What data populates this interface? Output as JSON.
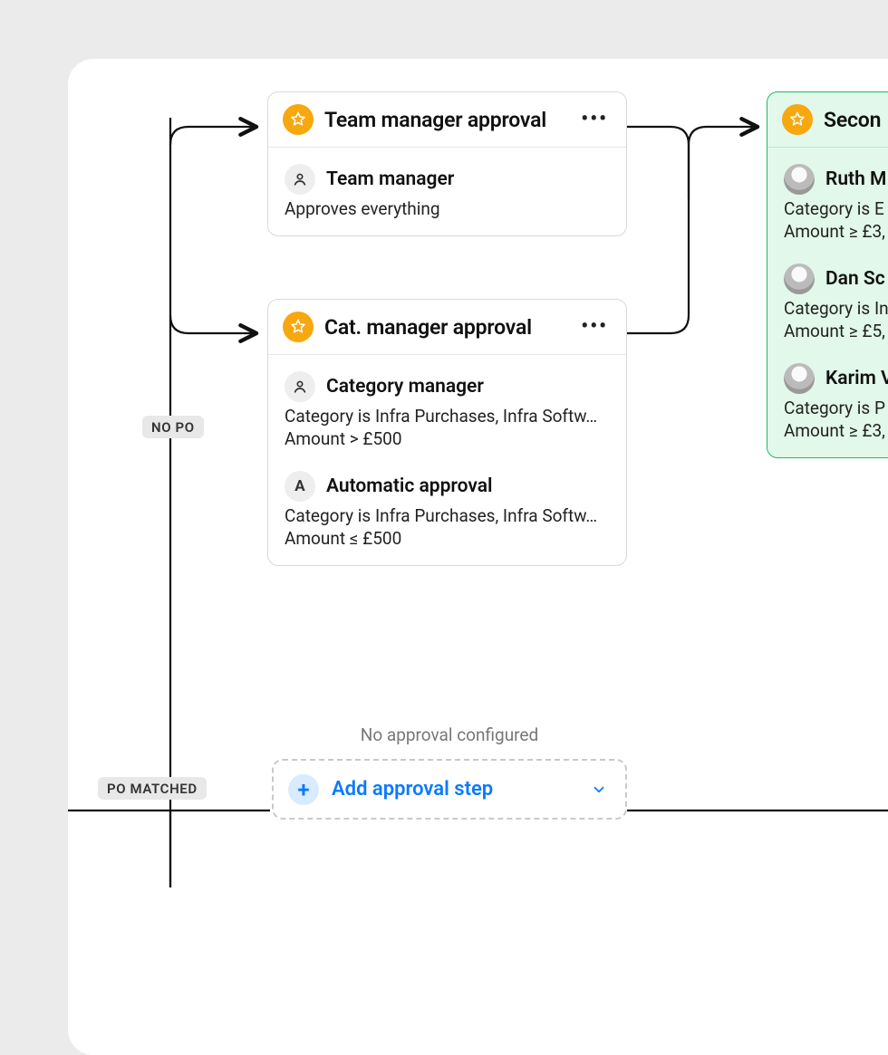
{
  "branches": {
    "no_po": "NO PO",
    "po_matched": "PO MATCHED"
  },
  "cards": {
    "team": {
      "title": "Team manager approval",
      "entries": [
        {
          "kind": "role",
          "name": "Team manager",
          "lines": [
            "Approves everything"
          ]
        }
      ]
    },
    "cat": {
      "title": "Cat. manager approval",
      "entries": [
        {
          "kind": "role",
          "name": "Category manager",
          "lines": [
            "Category is Infra Purchases, Infra Softw…",
            "Amount > £500"
          ]
        },
        {
          "kind": "auto",
          "letter": "A",
          "name": "Automatic approval",
          "lines": [
            "Category is Infra Purchases, Infra Softw…",
            "Amount ≤ £500"
          ]
        }
      ]
    },
    "second": {
      "title": "Secon",
      "entries": [
        {
          "kind": "person",
          "name": "Ruth M",
          "lines": [
            "Category is E",
            "Amount ≥ £3,"
          ]
        },
        {
          "kind": "person",
          "name": "Dan Sc",
          "lines": [
            "Category is In",
            "Amount ≥ £5,"
          ]
        },
        {
          "kind": "person",
          "name": "Karim V",
          "lines": [
            "Category is P",
            "Amount ≥ £3,"
          ]
        }
      ]
    }
  },
  "empty": {
    "text": "No approval configured",
    "add_label": "Add approval step"
  }
}
